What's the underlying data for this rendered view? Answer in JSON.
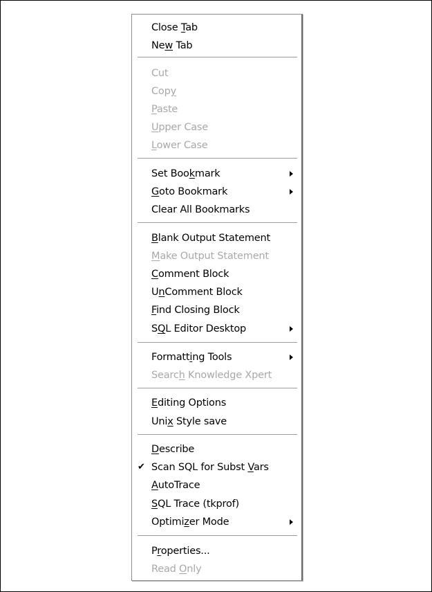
{
  "menu": {
    "close_tab": "Close Tab",
    "new_tab": "New Tab",
    "cut": "Cut",
    "copy": "Copy",
    "paste": "Paste",
    "upper_case": "Upper Case",
    "lower_case": "Lower Case",
    "set_bookmark": "Set Bookmark",
    "goto_bookmark": "Goto Bookmark",
    "clear_all_bookmarks": "Clear All Bookmarks",
    "blank_output_statement": "Blank Output Statement",
    "make_output_statement": "Make Output Statement",
    "comment_block": "Comment Block",
    "uncomment_block": "UnComment Block",
    "find_closing_block": "Find Closing Block",
    "sql_editor_desktop": "SQL Editor Desktop",
    "formatting_tools": "Formatting Tools",
    "search_knowledge_xpert": "Search Knowledge Xpert",
    "editing_options": "Editing Options",
    "unix_style_save": "Unix Style save",
    "describe": "Describe",
    "scan_sql_for_subst_vars": "Scan SQL for Subst Vars",
    "autotrace": "AutoTrace",
    "sql_trace_tkprof": "SQL Trace (tkprof)",
    "optimizer_mode": "Optimizer Mode",
    "properties": "Properties...",
    "read_only": "Read Only"
  },
  "state": {
    "scan_sql_for_subst_vars_checked": true
  },
  "icons": {
    "submenu": "submenu-arrow-icon",
    "check": "check-icon"
  },
  "colors": {
    "enabled_text": "#000000",
    "disabled_text": "#a8a8a8",
    "separator": "#9a9a9a"
  }
}
